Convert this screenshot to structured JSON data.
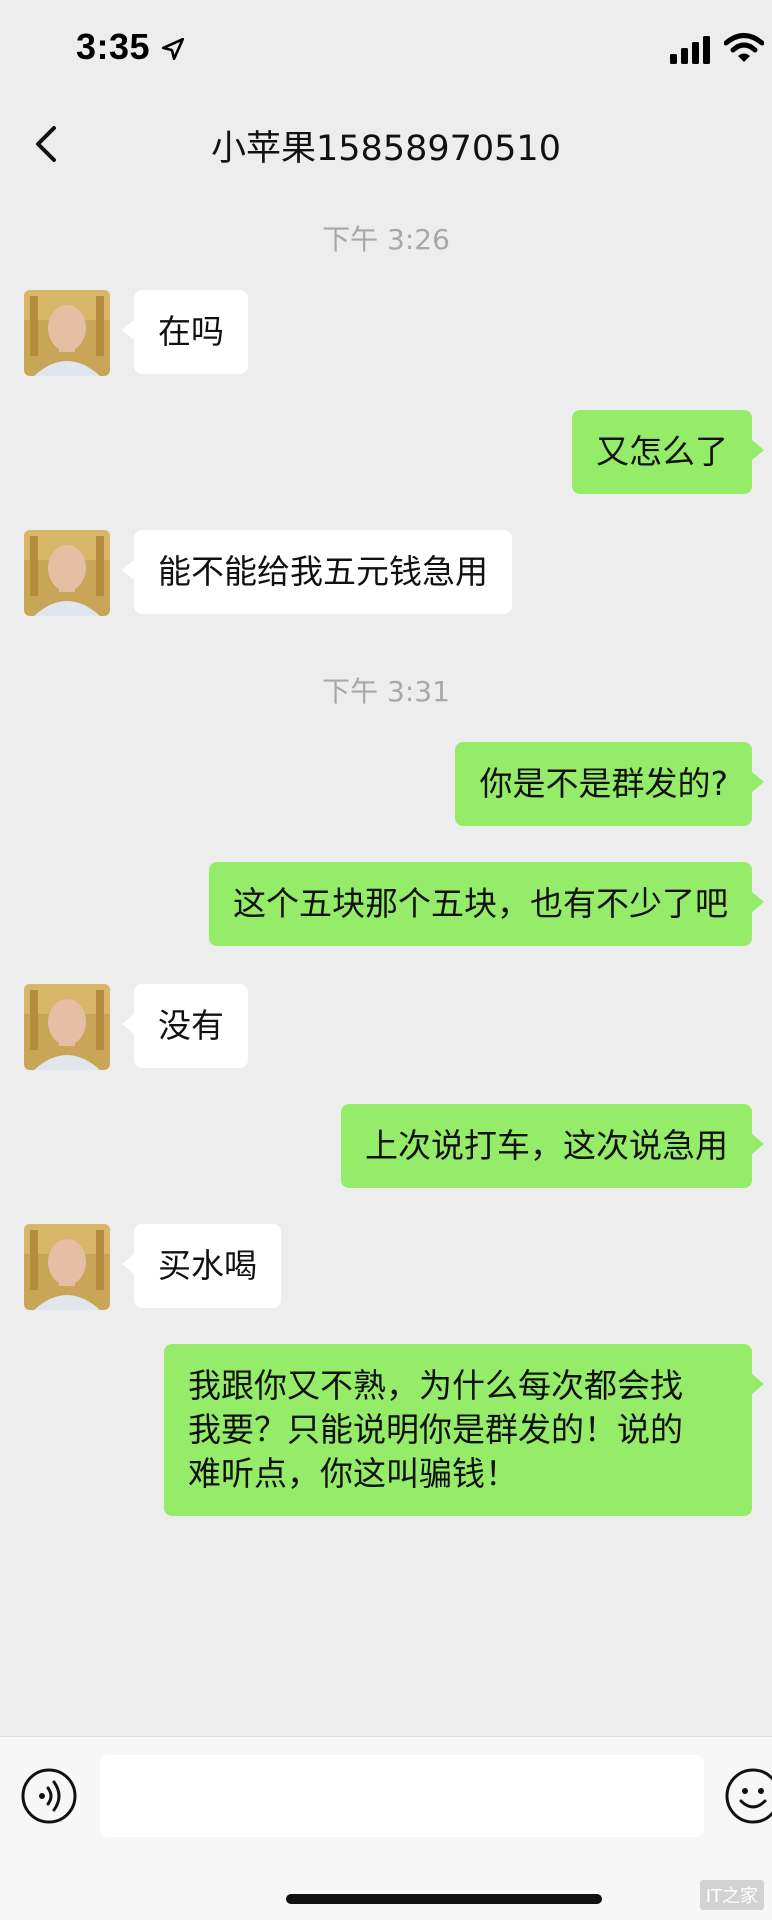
{
  "status_bar": {
    "time": "3:35"
  },
  "nav": {
    "title": "小苹果15858970510"
  },
  "chat": {
    "timestamps": [
      "下午 3:26",
      "下午 3:31"
    ],
    "messages": [
      {
        "side": "left",
        "text": "在吗"
      },
      {
        "side": "right",
        "text": "又怎么了"
      },
      {
        "side": "left",
        "text": "能不能给我五元钱急用"
      },
      {
        "side": "right",
        "text": "你是不是群发的?"
      },
      {
        "side": "right",
        "text": "这个五块那个五块，也有不少了吧"
      },
      {
        "side": "left",
        "text": "没有"
      },
      {
        "side": "right",
        "text": "上次说打车，这次说急用"
      },
      {
        "side": "left",
        "text": "买水喝"
      },
      {
        "side": "right",
        "text": "我跟你又不熟，为什么每次都会找\n我要？只能说明你是群发的！说的\n难听点，你这叫骗钱！"
      }
    ]
  },
  "input_bar": {
    "value": ""
  },
  "watermark": "IT之家",
  "colors": {
    "background": "#ededed",
    "incoming_bubble": "#ffffff",
    "outgoing_bubble": "#95ec69",
    "timestamp_text": "#a8a8a8"
  }
}
